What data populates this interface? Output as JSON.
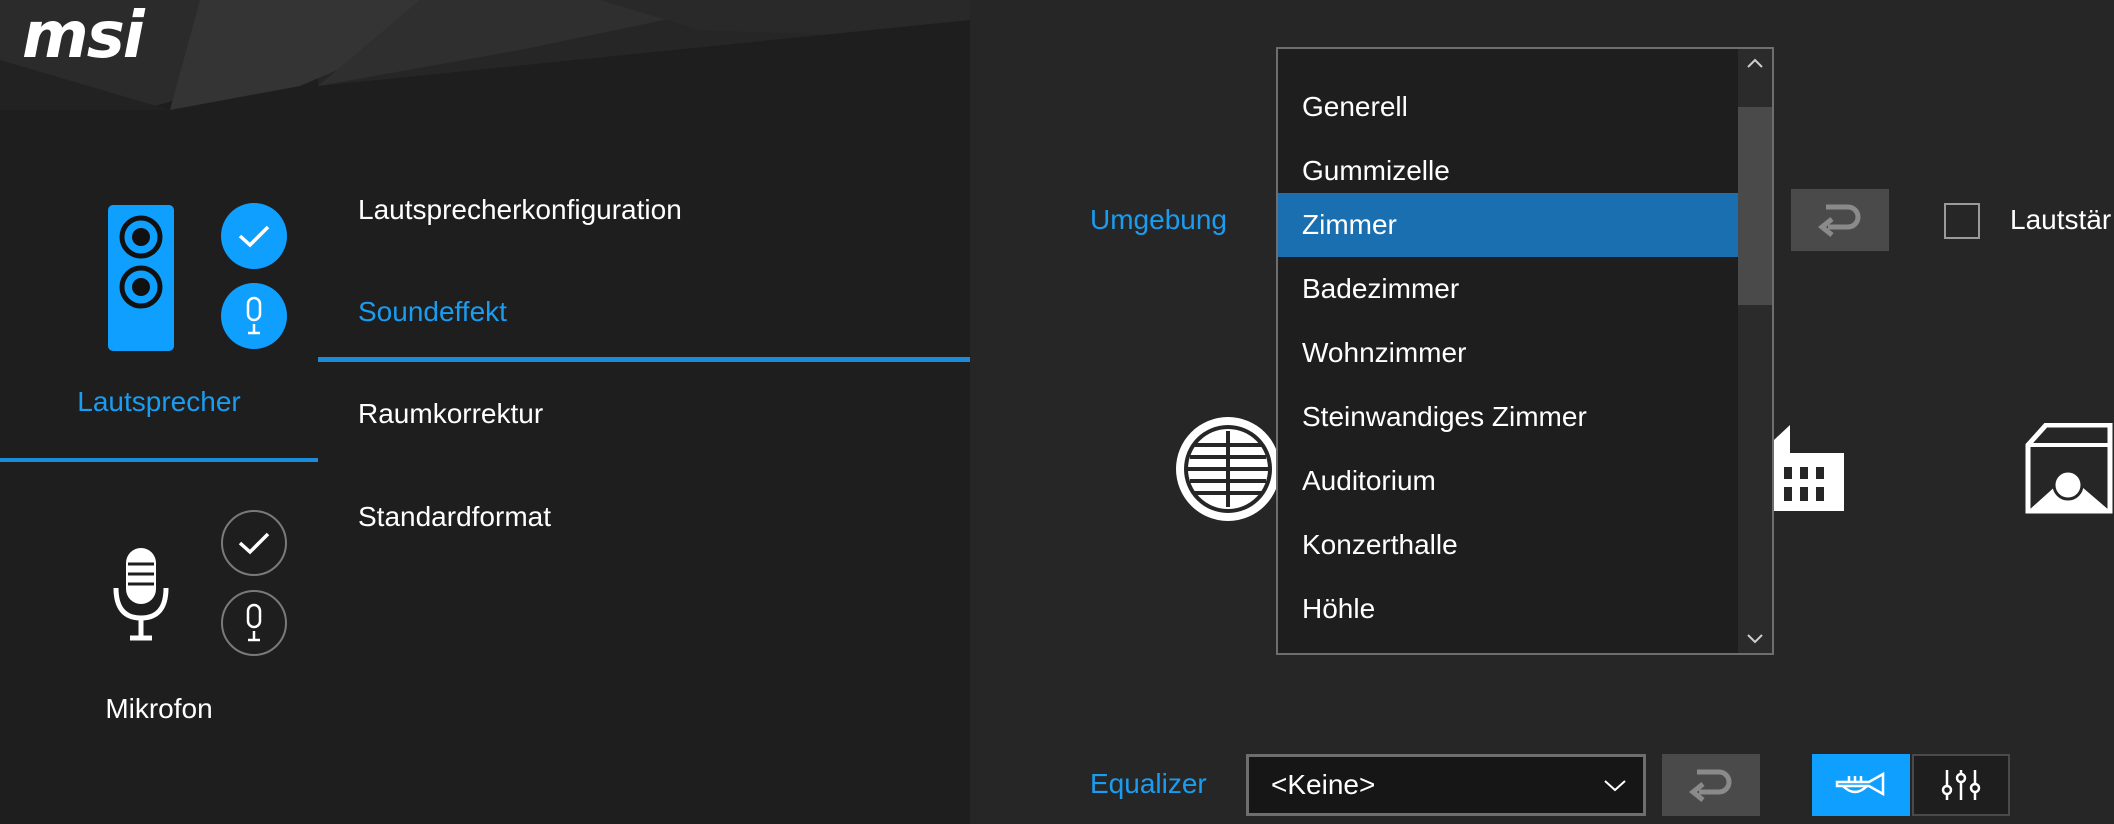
{
  "brand": {
    "logo_text": "msi"
  },
  "devices": [
    {
      "label": "Lautsprecher",
      "active": true
    },
    {
      "label": "Mikrofon",
      "active": false
    }
  ],
  "nav": {
    "items": [
      "Lautsprecherkonfiguration",
      "Soundeffekt",
      "Raumkorrektur",
      "Standardformat"
    ],
    "active_index": 1
  },
  "environment": {
    "label": "Umgebung",
    "options": [
      "Generell",
      "Gummizelle",
      "Zimmer",
      "Badezimmer",
      "Wohnzimmer",
      "Steinwandiges Zimmer",
      "Auditorium",
      "Konzerthalle",
      "Höhle"
    ],
    "selected": "Zimmer",
    "loudness_label": "Lautstär"
  },
  "equalizer": {
    "label": "Equalizer",
    "value": "<Keine>"
  },
  "colors": {
    "accent": "#1a9cf0",
    "selected_bg": "#1a6fb0",
    "panel_bg": "#1e1e1e",
    "content_bg": "#262626"
  },
  "icons": {
    "scroll_up": "chevron-up-icon",
    "scroll_down": "chevron-down-icon",
    "reset": "undo-arrow-icon"
  }
}
